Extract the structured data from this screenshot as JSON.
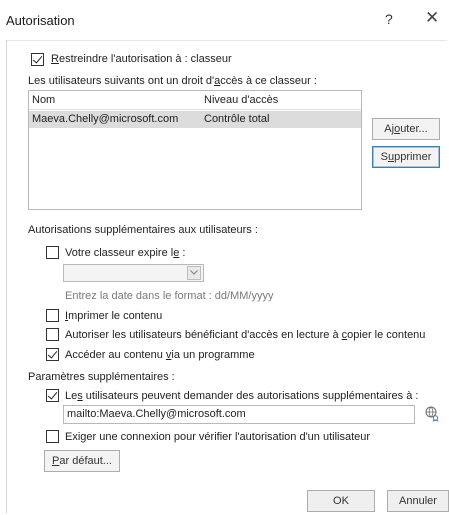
{
  "dialog": {
    "title": "Autorisation",
    "help_glyph": "?",
    "close_glyph": "✕"
  },
  "restrict": {
    "checked": true,
    "label_u": "R",
    "label_rest": "estreindre l'autorisation à : classeur"
  },
  "users_label_pre": "Les utilisateurs suivants ont un droit d'",
  "users_label_u": "a",
  "users_label_post": "ccès à ce classeur :",
  "table": {
    "headers": [
      "Nom",
      "Niveau d'accès"
    ],
    "rows": [
      [
        "Maeva.Chelly@microsoft.com",
        "Contrôle total"
      ]
    ]
  },
  "buttons": {
    "add_pre": "Aj",
    "add_u": "o",
    "add_post": "uter...",
    "remove_pre": "S",
    "remove_u": "u",
    "remove_post": "pprimer",
    "defaults_u": "P",
    "defaults_post": "ar défaut...",
    "ok": "OK",
    "cancel": "Annuler"
  },
  "extra_perms": {
    "heading": "Autorisations supplémentaires aux utilisateurs :",
    "expire_pre": "Votre classeur expire l",
    "expire_u": "e",
    "expire_post": " :",
    "date_hint": "Entrez la date dans le format : dd/MM/yyyy",
    "print_u": "I",
    "print_post": "mprimer le contenu",
    "copy_pre": "Autoriser les utilisateurs bénéficiant d'accès en lecture à ",
    "copy_u": "c",
    "copy_post": "opier le contenu",
    "program_pre": "Accéder au contenu ",
    "program_u": "v",
    "program_post": "ia un programme"
  },
  "extra_params": {
    "heading": "Paramètres supplémentaires :",
    "request_pre": "Le",
    "request_u": "s",
    "request_post": " utilisateurs peuvent demander des autorisations supplémentaires à :",
    "mailto": "mailto:Maeva.Chelly@microsoft.com",
    "require_pre": "Exi",
    "require_u": "g",
    "require_post": "er une connexion pour vérifier l'autorisation d'un utilisateur"
  }
}
